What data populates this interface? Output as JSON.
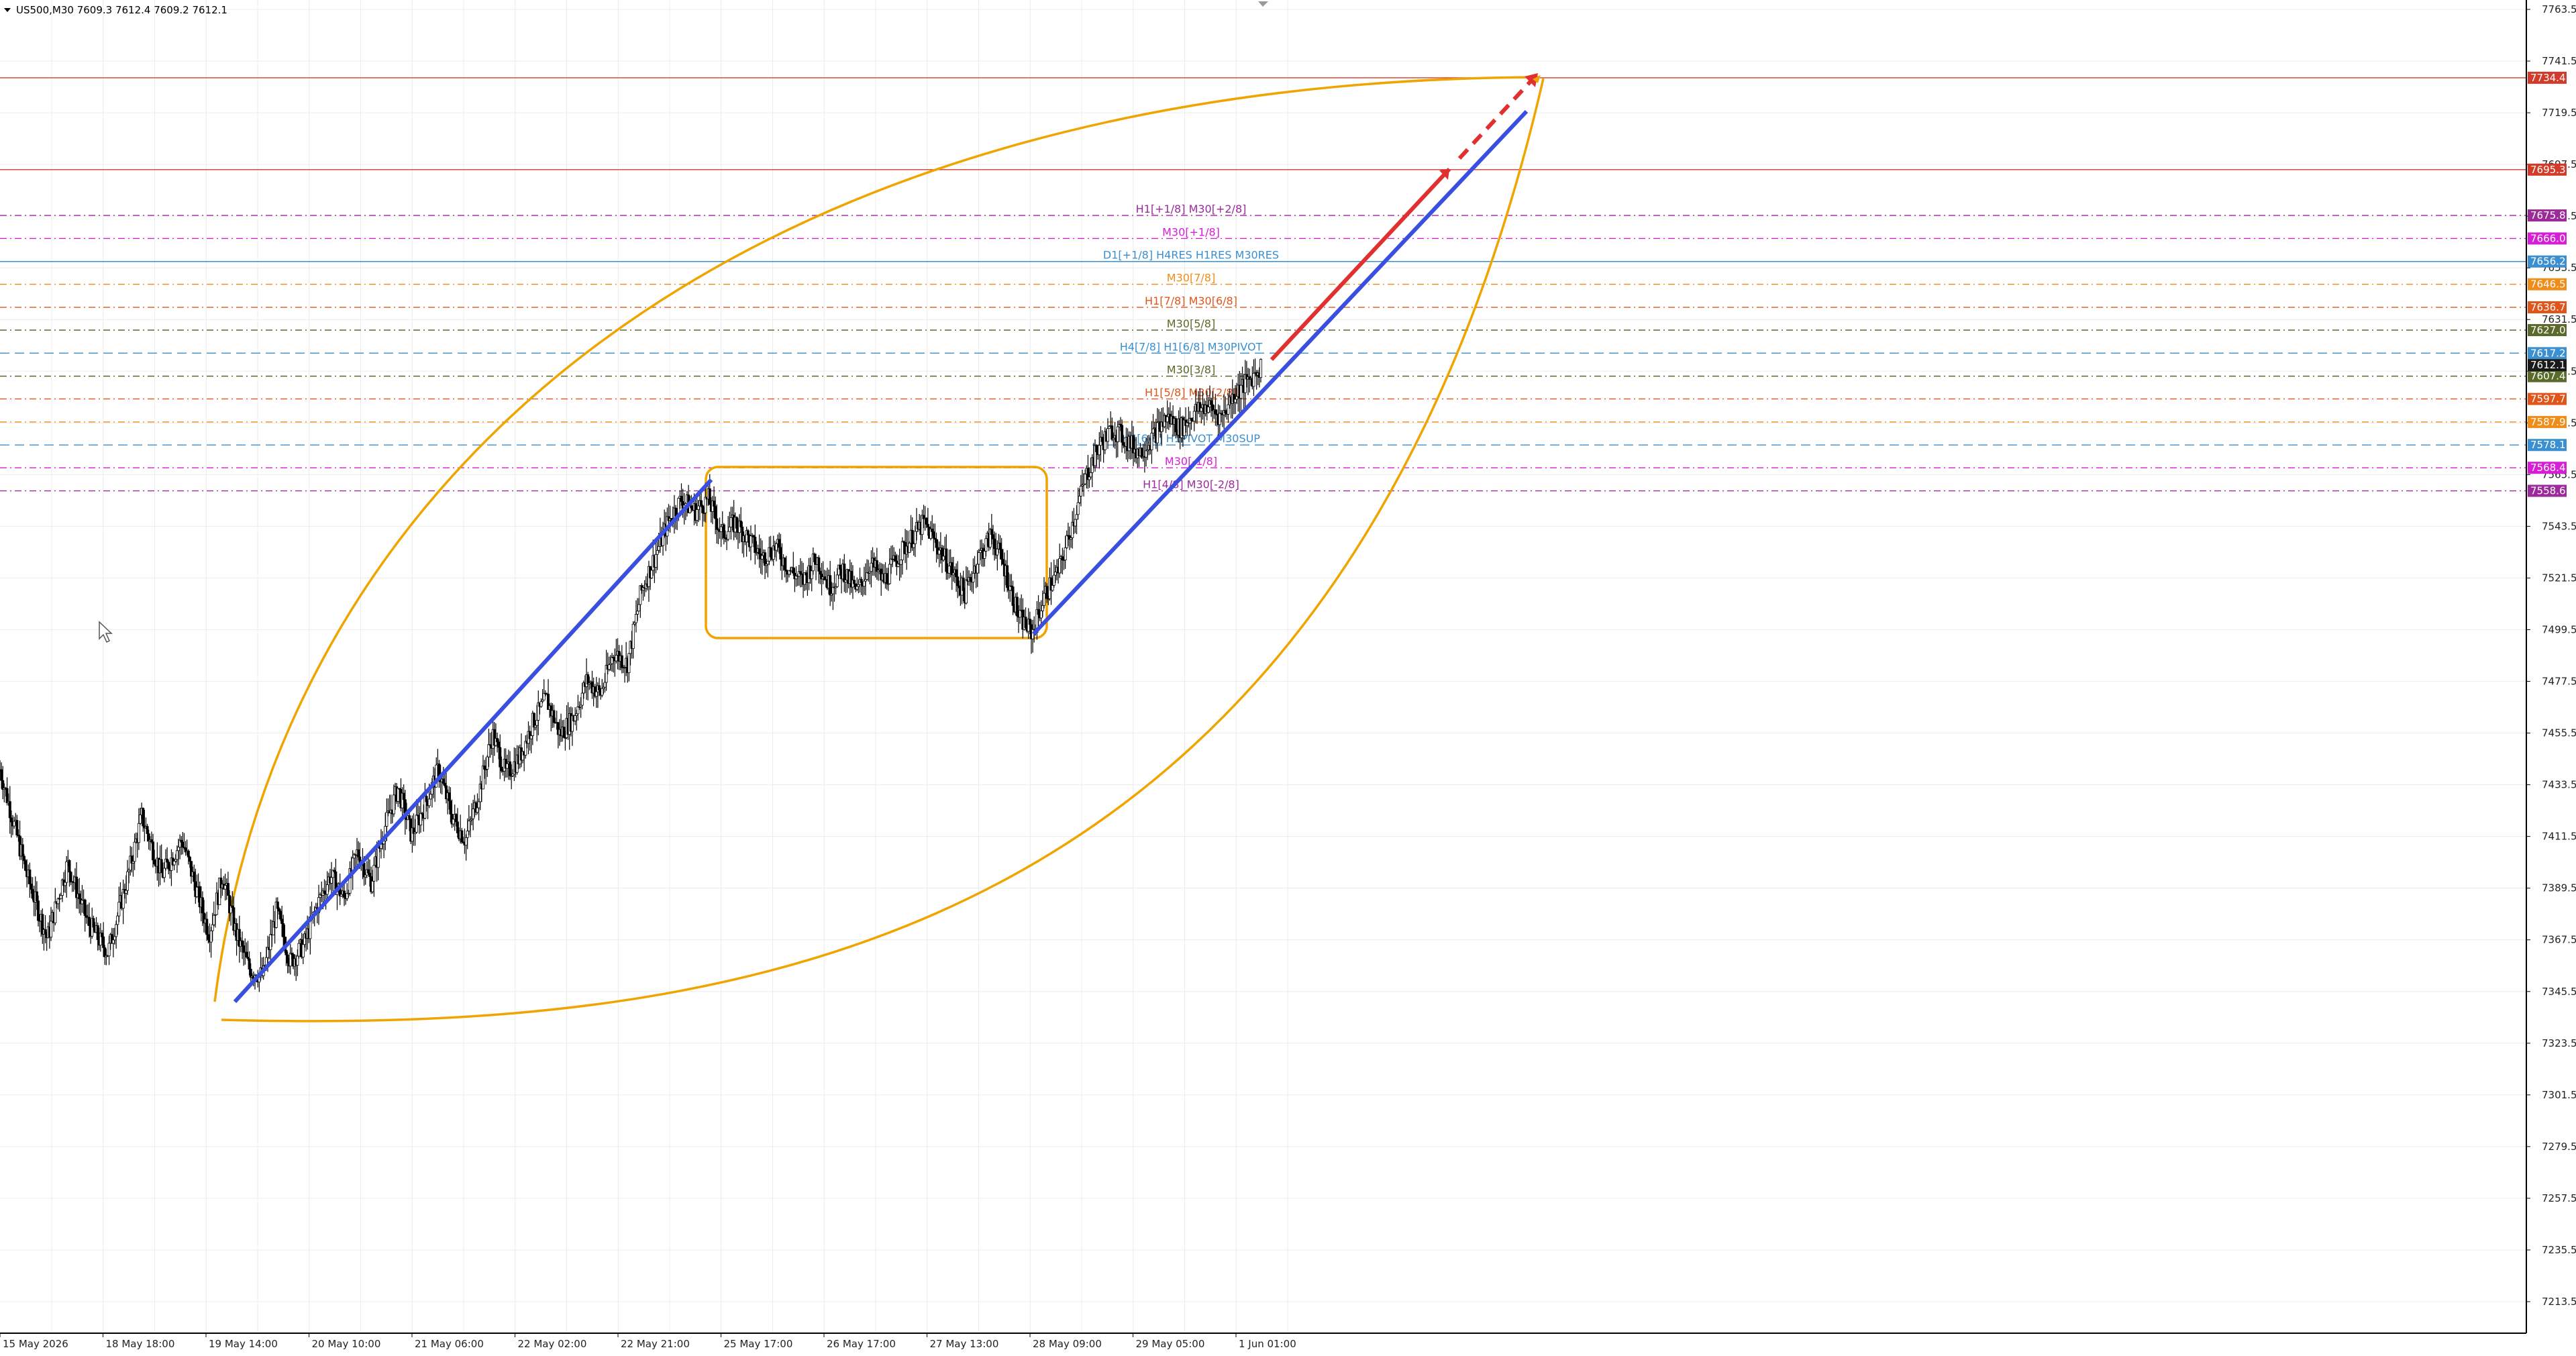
{
  "header": {
    "symbol_info": "US500,M30 7609.3 7612.4 7609.2 7612.1"
  },
  "colors": {
    "background": "#ffffff",
    "grid": "#e6e6e6",
    "bull_candle": "#000000",
    "bear_candle": "#000000",
    "trendline": "#3a4fe0",
    "projection": "#e03030",
    "shapes": "#f0a400",
    "resistance": "#c0392b"
  },
  "chart_data": {
    "type": "candlestick",
    "title": "US500,M30",
    "ylim": [
      7200,
      7770
    ],
    "y_ticks": [
      "7763.5",
      "7741.5",
      "7719.5",
      "7697.5",
      "7675.5",
      "7653.5",
      "7631.5",
      "7609.5",
      "7587.5",
      "7565.5",
      "7543.5",
      "7521.5",
      "7499.5",
      "7477.5",
      "7455.5",
      "7433.5",
      "7411.5",
      "7389.5",
      "7367.5",
      "7345.5",
      "7323.5",
      "7301.5",
      "7279.5",
      "7257.5",
      "7235.5",
      "7213.5"
    ],
    "x_labels": [
      "15 May 2026",
      "18 May 18:00",
      "19 May 14:00",
      "20 May 10:00",
      "21 May 06:00",
      "22 May 02:00",
      "22 May 21:00",
      "25 May 17:00",
      "26 May 17:00",
      "27 May 13:00",
      "28 May 09:00",
      "29 May 05:00",
      "1 Jun 01:00"
    ],
    "last_price": 7612.1,
    "price_path": [
      [
        0,
        7440
      ],
      [
        8,
        7395
      ],
      [
        14,
        7368
      ],
      [
        20,
        7400
      ],
      [
        26,
        7375
      ],
      [
        32,
        7362
      ],
      [
        38,
        7395
      ],
      [
        42,
        7420
      ],
      [
        48,
        7395
      ],
      [
        54,
        7410
      ],
      [
        58,
        7390
      ],
      [
        62,
        7370
      ],
      [
        66,
        7395
      ],
      [
        70,
        7370
      ],
      [
        74,
        7355
      ],
      [
        78,
        7352
      ],
      [
        82,
        7380
      ],
      [
        86,
        7358
      ],
      [
        90,
        7365
      ],
      [
        94,
        7382
      ],
      [
        98,
        7395
      ],
      [
        102,
        7385
      ],
      [
        106,
        7405
      ],
      [
        110,
        7392
      ],
      [
        114,
        7415
      ],
      [
        118,
        7432
      ],
      [
        122,
        7412
      ],
      [
        126,
        7425
      ],
      [
        130,
        7440
      ],
      [
        134,
        7420
      ],
      [
        138,
        7410
      ],
      [
        142,
        7430
      ],
      [
        146,
        7455
      ],
      [
        150,
        7438
      ],
      [
        154,
        7445
      ],
      [
        158,
        7460
      ],
      [
        162,
        7470
      ],
      [
        166,
        7455
      ],
      [
        170,
        7462
      ],
      [
        174,
        7478
      ],
      [
        178,
        7472
      ],
      [
        182,
        7490
      ],
      [
        186,
        7485
      ],
      [
        190,
        7515
      ],
      [
        194,
        7530
      ],
      [
        198,
        7545
      ],
      [
        202,
        7555
      ],
      [
        206,
        7550
      ],
      [
        210,
        7555
      ],
      [
        214,
        7540
      ],
      [
        218,
        7545
      ],
      [
        222,
        7538
      ],
      [
        226,
        7530
      ],
      [
        230,
        7535
      ],
      [
        234,
        7525
      ],
      [
        238,
        7520
      ],
      [
        242,
        7530
      ],
      [
        246,
        7518
      ],
      [
        250,
        7525
      ],
      [
        254,
        7515
      ],
      [
        258,
        7528
      ],
      [
        262,
        7520
      ],
      [
        266,
        7530
      ],
      [
        270,
        7538
      ],
      [
        274,
        7545
      ],
      [
        278,
        7535
      ],
      [
        282,
        7525
      ],
      [
        286,
        7515
      ],
      [
        290,
        7530
      ],
      [
        294,
        7540
      ],
      [
        298,
        7525
      ],
      [
        302,
        7505
      ],
      [
        306,
        7498
      ],
      [
        310,
        7515
      ],
      [
        314,
        7525
      ],
      [
        318,
        7545
      ],
      [
        322,
        7565
      ],
      [
        326,
        7578
      ],
      [
        330,
        7585
      ],
      [
        334,
        7580
      ],
      [
        338,
        7575
      ],
      [
        342,
        7582
      ],
      [
        346,
        7590
      ],
      [
        350,
        7585
      ],
      [
        354,
        7592
      ],
      [
        358,
        7595
      ],
      [
        362,
        7590
      ],
      [
        366,
        7600
      ],
      [
        370,
        7605
      ],
      [
        374,
        7612
      ]
    ],
    "candle_span": [
      0,
      3765
    ],
    "horizontal_levels": [
      {
        "price": 7734.4,
        "label": "",
        "badge": "7734.4",
        "color": "#d23a2a",
        "style": "solid"
      },
      {
        "price": 7695.3,
        "label": "",
        "badge": "7695.3",
        "color": "#d23a2a",
        "style": "solid"
      },
      {
        "price": 7675.8,
        "label": "H1[+1/8] M30[+2/8]",
        "badge": "7675.8",
        "color": "#9b2a9b",
        "style": "dashdot"
      },
      {
        "price": 7666.0,
        "label": "M30[+1/8]",
        "badge": "7666.0",
        "color": "#d61ed6",
        "style": "dashdot"
      },
      {
        "price": 7656.2,
        "label": "D1[+1/8] H4RES H1RES M30RES",
        "badge": "7656.2",
        "color": "#3a8fd0",
        "style": "solid"
      },
      {
        "price": 7646.5,
        "label": "M30[7/8]",
        "badge": "7646.5",
        "color": "#f08c18",
        "style": "dashdot"
      },
      {
        "price": 7636.7,
        "label": "H1[7/8] M30[6/8]",
        "badge": "7636.7",
        "color": "#e0561a",
        "style": "dashdot"
      },
      {
        "price": 7627.0,
        "label": "M30[5/8]",
        "badge": "7627.0",
        "color": "#5a6a2a",
        "style": "dashdot"
      },
      {
        "price": 7617.2,
        "label": "H4[7/8] H1[6/8] M30PIVOT",
        "badge": "7617.2",
        "color": "#3a8fd0",
        "style": "dashed"
      },
      {
        "price": 7607.4,
        "label": "M30[3/8]",
        "badge": "7607.4",
        "color": "#5a6a2a",
        "style": "dashdot"
      },
      {
        "price": 7597.7,
        "label": "H1[5/8] M30[2/8]",
        "badge": "7597.7",
        "color": "#e0561a",
        "style": "dashdot"
      },
      {
        "price": 7587.9,
        "label": "",
        "badge": "7587.9",
        "color": "#f08c18",
        "style": "dashdot"
      },
      {
        "price": 7578.1,
        "label": "H4[6/8] H1PIVOT M30SUP",
        "badge": "7578.1",
        "color": "#3a8fd0",
        "style": "dashed"
      },
      {
        "price": 7568.4,
        "label": "M30[-1/8]",
        "badge": "7568.4",
        "color": "#d61ed6",
        "style": "dashdot"
      },
      {
        "price": 7558.6,
        "label": "H1[4/8] M30[-2/8]",
        "badge": "7558.6",
        "color": "#9b2a9b",
        "style": "dashdot"
      }
    ]
  }
}
